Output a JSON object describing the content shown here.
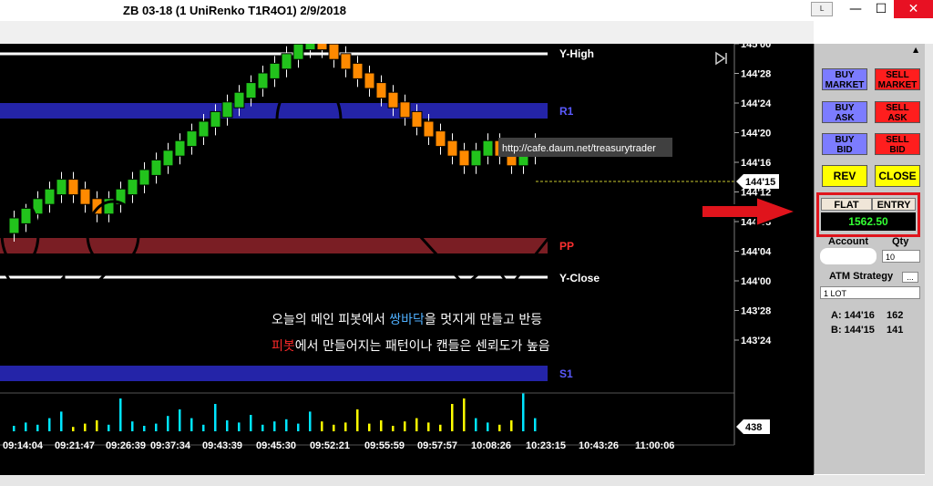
{
  "window": {
    "title": "ZB 03-18 (1 UniRenko T1R4O1)  2/9/2018",
    "minimize": "—",
    "maximize": "☐",
    "close": "✕",
    "small_btn": "L"
  },
  "colors": {
    "up_bar": "#22c31c",
    "down_bar": "#ff8a00",
    "r1_band": "#2424a8",
    "s1_band": "#2424a8",
    "pp_band": "#7a1e24",
    "level_line": "#ffffff",
    "label_text": "#ffffff",
    "pp_text": "#ff3030",
    "r_s_text": "#5a5aff",
    "highlight_red": "#e0141c"
  },
  "chart": {
    "watermark": "http://cafe.daum.net/treasurytrader",
    "levels": {
      "y_high": "Y-High",
      "r1": "R1",
      "pp": "PP",
      "y_close": "Y-Close",
      "s1": "S1"
    },
    "price_axis": [
      "145'00",
      "144'28",
      "144'24",
      "144'20",
      "144'16",
      "144'12",
      "144'08",
      "144'04",
      "144'00",
      "143'28",
      "143'24"
    ],
    "current_price": "144'15",
    "volume_label": "438",
    "time_axis": [
      "09:14:04",
      "09:21:47",
      "09:26:39",
      "09:37:34",
      "09:43:39",
      "09:45:30",
      "09:52:21",
      "09:55:59",
      "09:57:57",
      "10:08:26",
      "10:23:15",
      "10:43:26",
      "11:00:06"
    ],
    "annotation": {
      "line1_pre": "오늘의 메인 피봇에서 ",
      "line1_highlight": "쌍바닥",
      "line1_post": "을 멋지게 만들고 반등",
      "line2_highlight": "피봇",
      "line2_post": "에서 만들어지는 패턴이나 캔들은 센뢰도가 높음"
    }
  },
  "chart_data": {
    "type": "bar",
    "title": "ZB 03-18 (1 UniRenko T1R4O1)  2/9/2018",
    "price_unit": "32nds",
    "levels": {
      "Y-High": 145.5,
      "R1": 144.25,
      "PP": 144.1,
      "Y-Close": 144.03,
      "S1": 143.22
    },
    "bricks_direction": [
      "up",
      "up",
      "up",
      "up",
      "up",
      "down",
      "down",
      "down",
      "up",
      "up",
      "up",
      "up",
      "up",
      "up",
      "up",
      "up",
      "up",
      "up",
      "up",
      "up",
      "up",
      "up",
      "up",
      "up",
      "up",
      "up",
      "down",
      "down",
      "down",
      "down",
      "down",
      "down",
      "down",
      "down",
      "down",
      "down",
      "down",
      "down",
      "down",
      "up",
      "up",
      "down",
      "down",
      "up",
      "up"
    ],
    "volume": [
      5,
      8,
      6,
      12,
      18,
      4,
      7,
      10,
      6,
      30,
      9,
      5,
      7,
      14,
      20,
      12,
      6,
      25,
      10,
      8,
      15,
      6,
      9,
      11,
      7,
      18,
      9,
      6,
      8,
      20,
      7,
      10,
      5,
      9,
      12,
      8,
      6,
      25,
      30,
      12,
      8,
      6,
      10,
      35,
      12
    ]
  },
  "panel": {
    "buy_market": "BUY\nMARKET",
    "sell_market": "SELL\nMARKET",
    "buy_ask": "BUY\nASK",
    "sell_ask": "SELL\nASK",
    "buy_bid": "BUY\nBID",
    "sell_bid": "SELL\nBID",
    "rev": "REV",
    "close": "CLOSE",
    "flat": "FLAT",
    "entry": "ENTRY",
    "pnl": "1562.50",
    "account_label": "Account",
    "qty_label": "Qty",
    "qty_value": "10",
    "atm_label": "ATM Strategy",
    "atm_btn": "...",
    "atm_value": "1 LOT",
    "ask_label": "A: 144'16",
    "ask_size": "162",
    "bid_label": "B: 144'15",
    "bid_size": "141"
  }
}
